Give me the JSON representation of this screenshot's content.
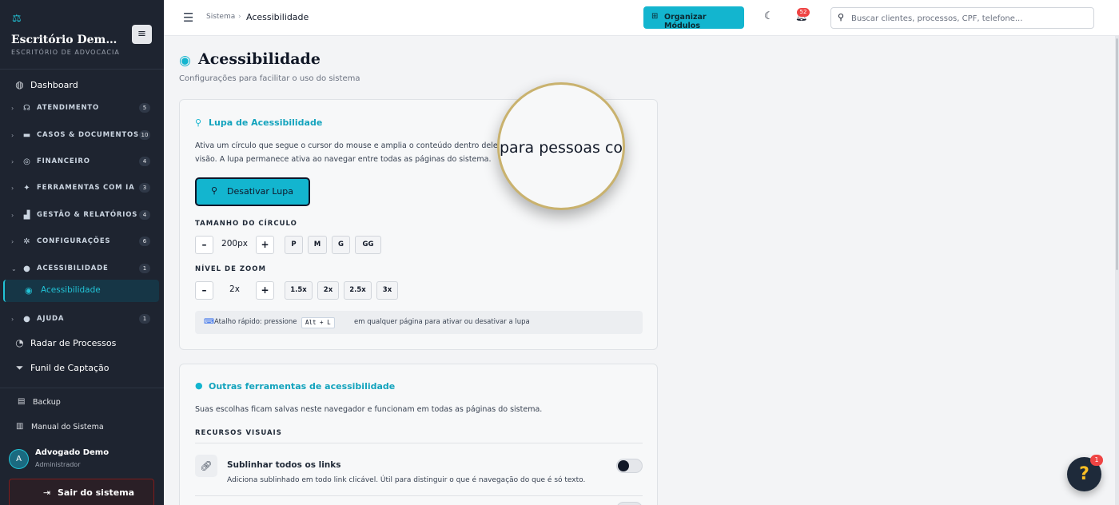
{
  "sidebar": {
    "brand_name": "Escritório Dem…",
    "brand_sub": "ESCRITÓRIO DE ADVOCACIA",
    "collapse_icon": "hamburger-icon",
    "dashboard": "Dashboard",
    "groups": [
      {
        "label": "ATENDIMENTO",
        "count": "5",
        "icon": "headset-icon"
      },
      {
        "label": "CASOS & DOCUMENTOS",
        "count": "10",
        "icon": "folder-icon"
      },
      {
        "label": "FINANCEIRO",
        "count": "4",
        "icon": "coins-icon"
      },
      {
        "label": "FERRAMENTAS COM IA",
        "count": "3",
        "icon": "magic-wand-icon"
      },
      {
        "label": "GESTÃO & RELATÓRIOS",
        "count": "4",
        "icon": "chart-icon"
      },
      {
        "label": "CONFIGURAÇÕES",
        "count": "6",
        "icon": "gear-icon"
      },
      {
        "label": "ACESSIBILIDADE",
        "count": "1",
        "icon": "accessibility-icon"
      }
    ],
    "active_sub": "Acessibilidade",
    "ajuda": {
      "label": "AJUDA",
      "count": "1"
    },
    "radar": "Radar de Processos",
    "funil": "Funil de Captação",
    "backup": "Backup",
    "manual": "Manual do Sistema",
    "user": {
      "initial": "A",
      "name": "Advogado Demo",
      "role": "Administrador"
    },
    "logout": "Sair do sistema"
  },
  "topbar": {
    "crumb_root": "Sistema",
    "crumb_sep": "›",
    "crumb_current": "Acessibilidade",
    "organize_label": "Organizar Módulos",
    "notification_count": "52",
    "search_placeholder": "Buscar clientes, processos, CPF, telefone..."
  },
  "page": {
    "title": "Acessibilidade",
    "subtitle": "Configurações para facilitar o uso do sistema"
  },
  "lupa_card": {
    "title": "Lupa de Acessibilidade",
    "desc_line1": "Ativa um círculo que segue o cursor do mouse e amplia o conteúdo dentro dele",
    "desc_line2": "visão. A lupa permanece ativa ao navegar entre todas as páginas do sistema.",
    "toggle_label": "Desativar Lupa",
    "size_label": "TAMANHO DO CÍRCULO",
    "size_minus": "–",
    "size_value": "200px",
    "size_plus": "+",
    "size_presets": [
      "P",
      "M",
      "G",
      "GG"
    ],
    "zoom_label": "NÍVEL DE ZOOM",
    "zoom_minus": "–",
    "zoom_value": "2x",
    "zoom_plus": "+",
    "zoom_presets": [
      "1.5x",
      "2x",
      "2.5x",
      "3x"
    ],
    "shortcut_prefix": "Atalho rápido: pressione",
    "shortcut_key": "Alt + L",
    "shortcut_suffix": "em qualquer página para ativar ou desativar a lupa",
    "magnifier_text": "para pessoas com"
  },
  "outras_card": {
    "title": "Outras ferramentas de acessibilidade",
    "desc": "Suas escolhas ficam salvas neste navegador e funcionam em todas as páginas do sistema.",
    "section_label": "RECURSOS VISUAIS",
    "option_title": "Sublinhar todos os links",
    "option_desc": "Adiciona sublinhado em todo link clicável. Útil para distinguir o que é navegação do que é só texto."
  },
  "help": {
    "label": "?",
    "badge": "1"
  },
  "colors": {
    "accent": "#13b5cf",
    "sidebar_bg": "#1e2430",
    "danger": "#ef4444"
  }
}
